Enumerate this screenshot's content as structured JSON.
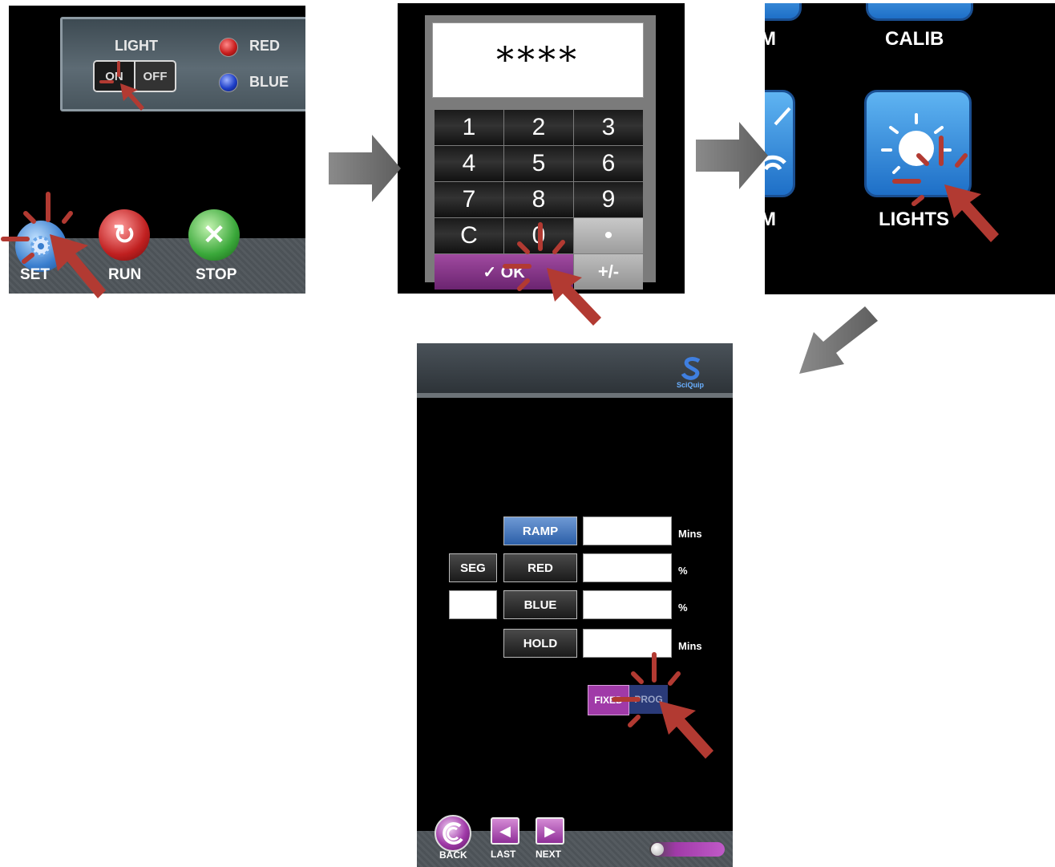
{
  "panel1": {
    "light_label": "LIGHT",
    "on_label": "ON",
    "off_label": "OFF",
    "red_label": "RED",
    "blue_label": "BLUE",
    "set_label": "SET",
    "run_label": "RUN",
    "stop_label": "STOP",
    "colors": {
      "red": "#c81e1e",
      "blue": "#1e3fc8",
      "run": "#c02020",
      "stop": "#3aa83a",
      "set": "#3b7fcf"
    }
  },
  "panel2": {
    "display": "****",
    "keys": [
      "1",
      "2",
      "3",
      "4",
      "5",
      "6",
      "7",
      "8",
      "9",
      "C",
      "0",
      "•"
    ],
    "ok_label": "✓ OK",
    "plusminus_label": "+/-"
  },
  "panel3": {
    "top_left_label": "M",
    "calib_label": "CALIB",
    "bottom_left_label": "M",
    "lights_label": "LIGHTS"
  },
  "panel4": {
    "logo_text": "SciQuip",
    "ramp_label": "RAMP",
    "seg_label": "SEG",
    "red_label": "RED",
    "blue_label": "BLUE",
    "hold_label": "HOLD",
    "unit_mins_1": "Mins",
    "unit_pct_1": "%",
    "unit_pct_2": "%",
    "unit_mins_2": "Mins",
    "fixed_label": "FIXED",
    "prog_label": "PROG",
    "back_label": "BACK",
    "last_label": "LAST",
    "next_label": "NEXT",
    "colors": {
      "accent": "#a03aa8",
      "ramp": "#3b6fb8",
      "prog": "#2a3a78"
    }
  }
}
